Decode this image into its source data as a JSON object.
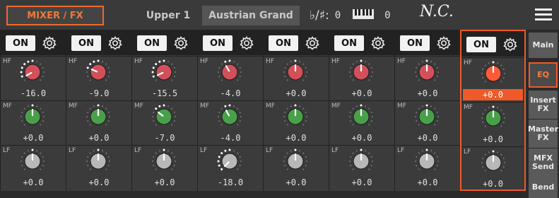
{
  "header": {
    "title": "MIXER / FX",
    "part": "Upper 1",
    "sound": "Austrian Grand",
    "key_symbol": "♭/♯:",
    "transpose": "0",
    "octave": "0",
    "chord": "N.C.",
    "menu_icon": "hamburger-menu-icon"
  },
  "strips": [
    {
      "on_label": "ON",
      "gear_icon": "gear-icon",
      "hf": {
        "label": "HF",
        "value": "-16.0"
      },
      "mf": {
        "label": "MF",
        "value": "+0.0"
      },
      "lf": {
        "label": "LF",
        "value": "+0.0"
      }
    },
    {
      "on_label": "ON",
      "gear_icon": "gear-icon",
      "hf": {
        "label": "HF",
        "value": "-9.0"
      },
      "mf": {
        "label": "MF",
        "value": "+0.0"
      },
      "lf": {
        "label": "LF",
        "value": "+0.0"
      }
    },
    {
      "on_label": "ON",
      "gear_icon": "gear-icon",
      "hf": {
        "label": "HF",
        "value": "-15.5"
      },
      "mf": {
        "label": "MF",
        "value": "-7.0"
      },
      "lf": {
        "label": "LF",
        "value": "+0.0"
      }
    },
    {
      "on_label": "ON",
      "gear_icon": "gear-icon",
      "hf": {
        "label": "HF",
        "value": "-4.0"
      },
      "mf": {
        "label": "MF",
        "value": "-4.0"
      },
      "lf": {
        "label": "LF",
        "value": "-18.0"
      }
    },
    {
      "on_label": "ON",
      "gear_icon": "gear-icon",
      "hf": {
        "label": "HF",
        "value": "+0.0"
      },
      "mf": {
        "label": "MF",
        "value": "+0.0"
      },
      "lf": {
        "label": "LF",
        "value": "+0.0"
      }
    },
    {
      "on_label": "ON",
      "gear_icon": "gear-icon",
      "hf": {
        "label": "HF",
        "value": "+0.0"
      },
      "mf": {
        "label": "MF",
        "value": "+0.0"
      },
      "lf": {
        "label": "LF",
        "value": "+0.0"
      }
    },
    {
      "on_label": "ON",
      "gear_icon": "gear-icon",
      "hf": {
        "label": "HF",
        "value": "+0.0"
      },
      "mf": {
        "label": "MF",
        "value": "+0.0"
      },
      "lf": {
        "label": "LF",
        "value": "+0.0"
      }
    },
    {
      "on_label": "ON",
      "gear_icon": "gear-icon",
      "hf": {
        "label": "HF",
        "value": "+0.0"
      },
      "mf": {
        "label": "MF",
        "value": "+0.0"
      },
      "lf": {
        "label": "LF",
        "value": "+0.0"
      }
    }
  ],
  "selected_strip": 7,
  "side_tabs": [
    {
      "label": "Main"
    },
    {
      "label": "EQ"
    },
    {
      "label": "Insert FX"
    },
    {
      "label": "Master FX"
    },
    {
      "label": "MFX Send"
    },
    {
      "label": "Bend"
    }
  ],
  "colors": {
    "accent": "#ef5a2a",
    "hf_knob": "#d2505a",
    "hf_knob_selected": "#ff5a3a",
    "mf_knob": "#4aa04a",
    "lf_knob": "#b8b8b8"
  }
}
